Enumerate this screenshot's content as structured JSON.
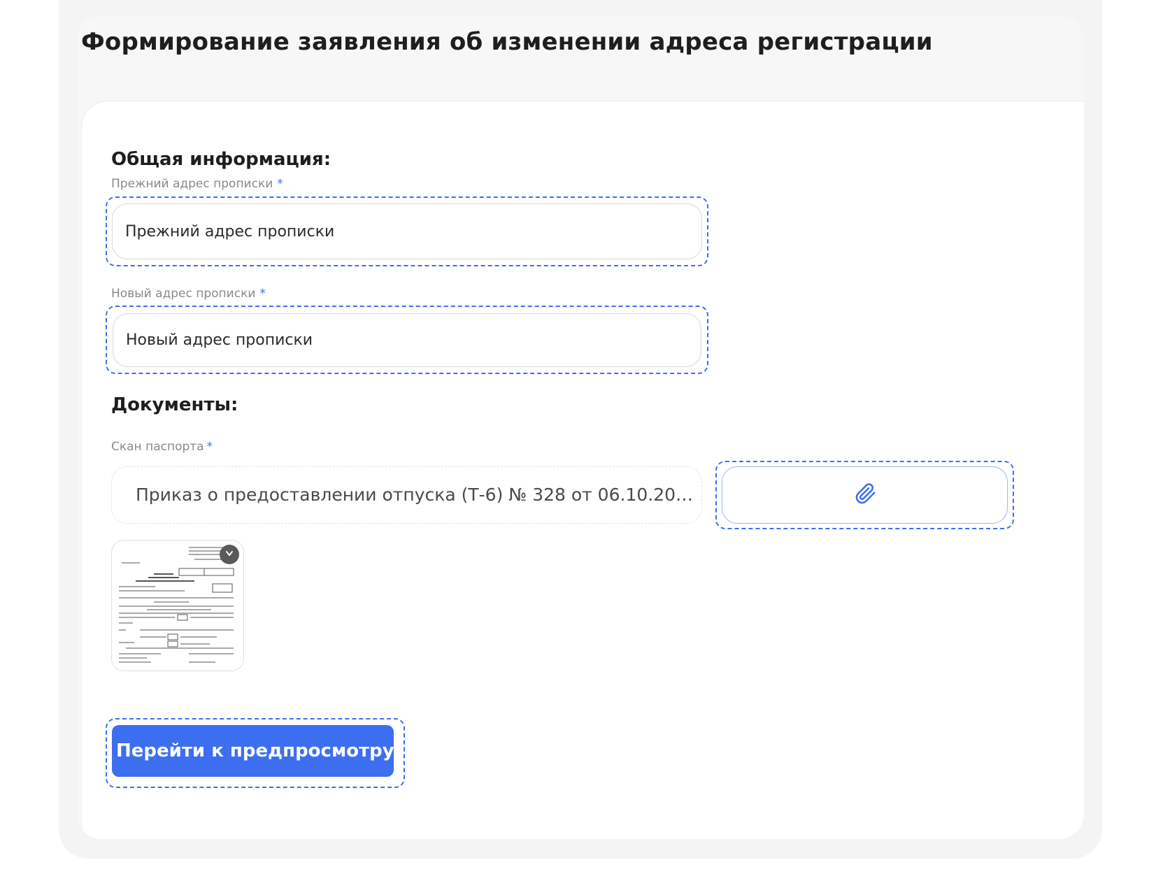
{
  "page": {
    "title": "Формирование заявления об изменении адреса регистрации"
  },
  "general": {
    "heading": "Общая информация:",
    "old_address": {
      "label": "Прежний адрес прописки",
      "required_mark": "*",
      "placeholder": "Прежний адрес прописки",
      "value": ""
    },
    "new_address": {
      "label": "Новый адрес прописки",
      "required_mark": "*",
      "placeholder": "Новый адрес прописки",
      "value": ""
    }
  },
  "documents": {
    "heading": "Документы:",
    "passport_scan": {
      "label": "Скан паспорта",
      "required_mark": "*",
      "file_name": "Приказ о предоставлении отпуска (Т-6) № 328 от 06.10.202...",
      "attach_icon": "paperclip-icon",
      "thumbnail_icon": "document-thumbnail",
      "remove_icon": "close-icon"
    }
  },
  "actions": {
    "preview_button": "Перейти к предпросмотру"
  },
  "colors": {
    "accent": "#3c6ef0",
    "panel_bg": "#f4f4f4",
    "card_bg": "#ffffff",
    "label_gray": "#8a8a8a"
  }
}
